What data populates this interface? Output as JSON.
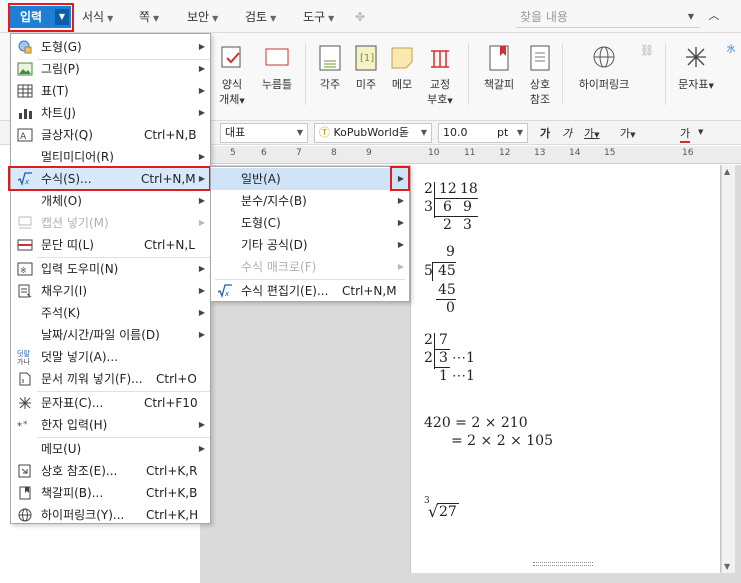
{
  "menubar": {
    "active": "입력",
    "items": [
      "서식",
      "쪽",
      "보안",
      "검토",
      "도구"
    ],
    "search_placeholder": "찾을 내용"
  },
  "ribbon": {
    "buttons": [
      {
        "label1": "양식",
        "label2": "개체"
      },
      {
        "label1": "누름틀",
        "label2": ""
      },
      {
        "label1": "각주",
        "label2": ""
      },
      {
        "label1": "미주",
        "label2": ""
      },
      {
        "label1": "메모",
        "label2": ""
      },
      {
        "label1": "교정",
        "label2": "부호"
      },
      {
        "label1": "책갈피",
        "label2": ""
      },
      {
        "label1": "상호",
        "label2": "참조"
      },
      {
        "label1": "하이퍼링크",
        "label2": ""
      },
      {
        "label1": "문자표",
        "label2": ""
      }
    ]
  },
  "format": {
    "style": "대표",
    "font": "KoPubWorld돋",
    "size": "10.0",
    "unit": "pt",
    "b1": "가",
    "b2": "가",
    "b3": "가",
    "b4": "가",
    "b5": "가"
  },
  "ruler": {
    "numbers": [
      "5",
      "6",
      "7",
      "8",
      "9",
      "10",
      "11",
      "12",
      "13",
      "14",
      "15",
      "16"
    ]
  },
  "main_menu": {
    "items": [
      {
        "label": "도형(G)",
        "shortcut": "",
        "sub": true,
        "disabled": false,
        "icon": "shape-icon"
      },
      {
        "label": "그림(P)",
        "shortcut": "",
        "sub": true,
        "disabled": false,
        "icon": "picture-icon"
      },
      {
        "label": "표(T)",
        "shortcut": "",
        "sub": true,
        "disabled": false,
        "icon": "table-icon"
      },
      {
        "label": "차트(J)",
        "shortcut": "",
        "sub": true,
        "disabled": false,
        "icon": "chart-icon"
      },
      {
        "label": "글상자(Q)",
        "shortcut": "Ctrl+N,B",
        "sub": false,
        "disabled": false,
        "icon": "textbox-icon"
      },
      {
        "label": "멀티미디어(R)",
        "shortcut": "",
        "sub": true,
        "disabled": false,
        "icon": ""
      },
      {
        "label": "수식(S)...",
        "shortcut": "Ctrl+N,M",
        "sub": true,
        "disabled": false,
        "icon": "equation-icon"
      },
      {
        "label": "개체(O)",
        "shortcut": "",
        "sub": true,
        "disabled": false,
        "icon": ""
      },
      {
        "label": "캡션 넣기(M)",
        "shortcut": "",
        "sub": true,
        "disabled": true,
        "icon": "caption-icon"
      },
      {
        "label": "문단 띠(L)",
        "shortcut": "Ctrl+N,L",
        "sub": false,
        "disabled": false,
        "icon": "paragraph-band-icon"
      },
      {
        "label": "입력 도우미(N)",
        "shortcut": "",
        "sub": true,
        "disabled": false,
        "icon": "input-helper-icon"
      },
      {
        "label": "채우기(I)",
        "shortcut": "",
        "sub": true,
        "disabled": false,
        "icon": "fill-icon"
      },
      {
        "label": "주석(K)",
        "shortcut": "",
        "sub": true,
        "disabled": false,
        "icon": ""
      },
      {
        "label": "날짜/시간/파일 이름(D)",
        "shortcut": "",
        "sub": true,
        "disabled": false,
        "icon": ""
      },
      {
        "label": "덧말 넣기(A)...",
        "shortcut": "",
        "sub": false,
        "disabled": false,
        "icon": "ruby-icon"
      },
      {
        "label": "문서 끼워 넣기(F)...",
        "shortcut": "Ctrl+O",
        "sub": false,
        "disabled": false,
        "icon": "insert-doc-icon"
      },
      {
        "label": "문자표(C)...",
        "shortcut": "Ctrl+F10",
        "sub": false,
        "disabled": false,
        "icon": "symbol-icon"
      },
      {
        "label": "한자 입력(H)",
        "shortcut": "",
        "sub": true,
        "disabled": false,
        "icon": "hanja-icon"
      },
      {
        "label": "메모(U)",
        "shortcut": "",
        "sub": true,
        "disabled": false,
        "icon": ""
      },
      {
        "label": "상호 참조(E)...",
        "shortcut": "Ctrl+K,R",
        "sub": false,
        "disabled": false,
        "icon": "cross-ref-icon"
      },
      {
        "label": "책갈피(B)...",
        "shortcut": "Ctrl+K,B",
        "sub": false,
        "disabled": false,
        "icon": "bookmark-icon"
      },
      {
        "label": "하이퍼링크(Y)...",
        "shortcut": "Ctrl+K,H",
        "sub": false,
        "disabled": false,
        "icon": "hyperlink-icon"
      }
    ]
  },
  "sub_menu": {
    "items": [
      {
        "label": "일반(A)",
        "shortcut": "",
        "sub": true,
        "disabled": false
      },
      {
        "label": "분수/지수(B)",
        "shortcut": "",
        "sub": true,
        "disabled": false
      },
      {
        "label": "도형(C)",
        "shortcut": "",
        "sub": true,
        "disabled": false
      },
      {
        "label": "기타 공식(D)",
        "shortcut": "",
        "sub": true,
        "disabled": false
      },
      {
        "label": "수식 매크로(F)",
        "shortcut": "",
        "sub": true,
        "disabled": true
      },
      {
        "label": "수식 편집기(E)...",
        "shortcut": "Ctrl+N,M",
        "sub": false,
        "disabled": false
      }
    ]
  },
  "math": {
    "a1": "2",
    "a2": "12",
    "a3": "18",
    "a4": "3",
    "a5": "6",
    "a6": "9",
    "a7": "2",
    "a8": "3",
    "b1": "9",
    "b2": "5",
    "b3": "45",
    "b4": "45",
    "b5": "0",
    "c1": "2",
    "c2": "7",
    "c3": "2",
    "c4": "3",
    "c5": "⋯1",
    "c6": "1",
    "c7": "⋯1",
    "d1": "420 =  2 × 210",
    "d2": "=  2 × 2 × 105",
    "e1": "3",
    "e2": "√",
    "e3": "27"
  },
  "colors": {
    "accent": "#1f7fd4",
    "highlight": "#e21b1b",
    "selected": "#d7e9fa"
  }
}
